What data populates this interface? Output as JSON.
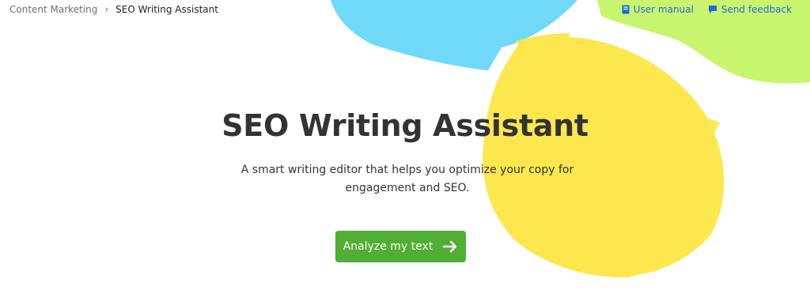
{
  "breadcrumb": {
    "parent": "Content Marketing",
    "current": "SEO Writing Assistant",
    "separator": "›"
  },
  "top_links": {
    "user_manual": "User manual",
    "send_feedback": "Send feedback"
  },
  "hero": {
    "title": "SEO Writing Assistant",
    "subtitle": "A smart writing editor that helps you optimize your copy for engagement and SEO.",
    "cta_label": "Analyze my text"
  },
  "colors": {
    "blob_blue": "#6fd9f7",
    "blob_green": "#c9f56e",
    "blob_yellow": "#fde74f",
    "cta_green": "#4fae33",
    "link_blue": "#1c6be0"
  },
  "icons": {
    "user_manual": "book-icon",
    "send_feedback": "speech-bubble-icon",
    "cta": "arrow-right-icon"
  }
}
